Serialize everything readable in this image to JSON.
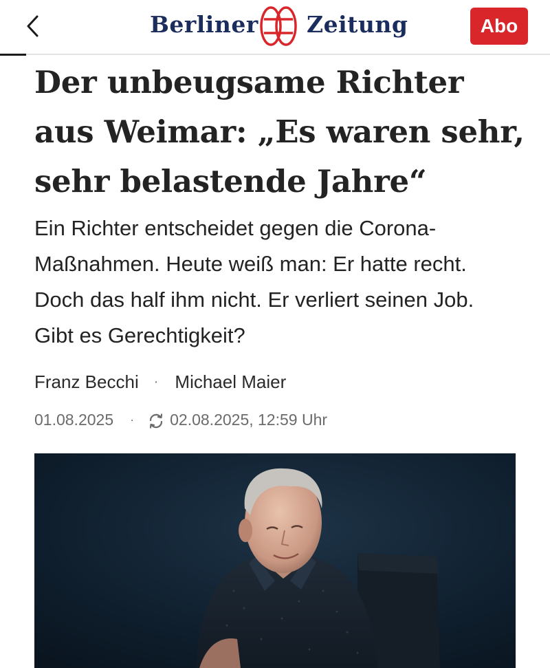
{
  "header": {
    "logo_left": "Berliner",
    "logo_right": "Zeitung",
    "subscribe_label": "Abo"
  },
  "article": {
    "headline": "Der unbeugsame Richter aus Weimar: „Es waren sehr, sehr belastende Jahre“",
    "subtitle": "Ein Richter entscheidet gegen die Corona-Maßnahmen. Heute weiß man: Er hatte recht. Doch das half ihm nicht. Er verliert seinen Job. Gibt es Gerechtigkeit?",
    "authors": [
      "Franz Becchi",
      "Michael Maier"
    ],
    "separator": "·",
    "published": "01.08.2025",
    "updated": "02.08.2025, 12:59 Uhr"
  },
  "colors": {
    "brand_blue": "#1b2d5c",
    "brand_red": "#d9262b",
    "text": "#232323",
    "meta": "#6b6b6b"
  },
  "icons": [
    "back-chevron-icon",
    "refresh-icon"
  ]
}
